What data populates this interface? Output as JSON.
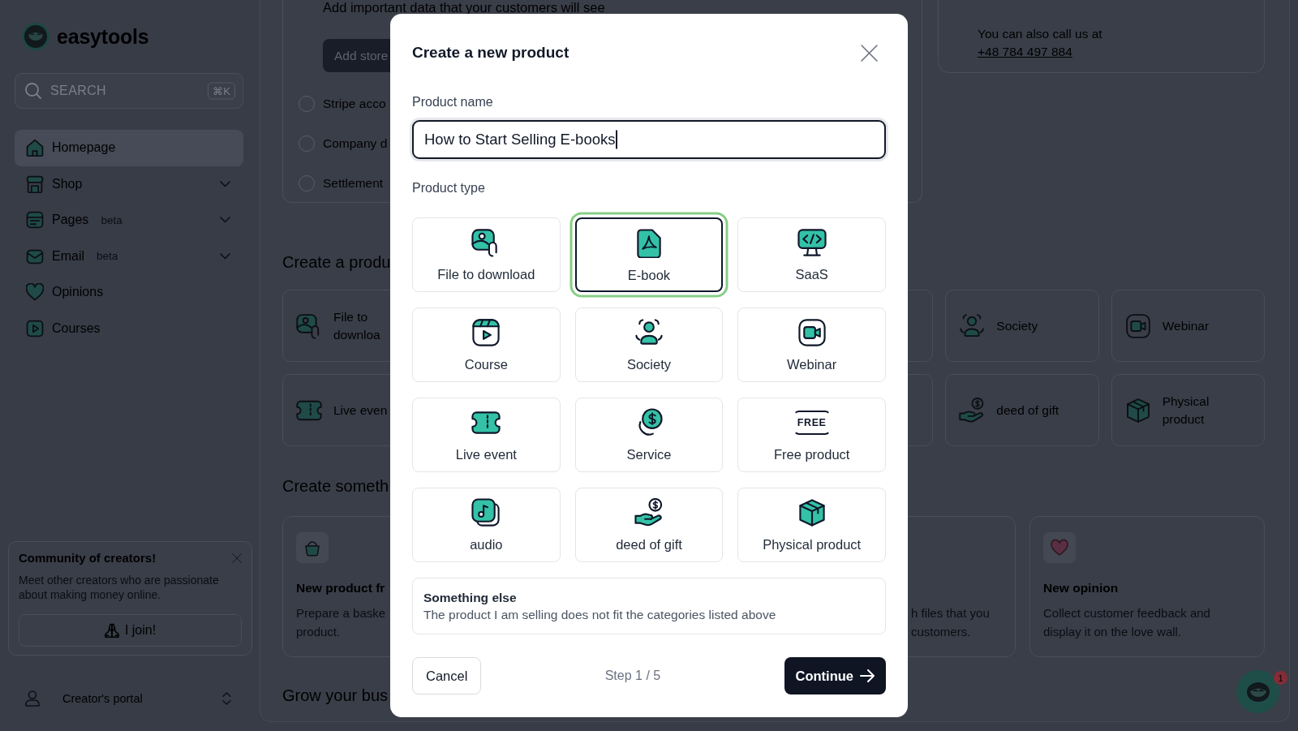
{
  "sidebar": {
    "brand": "easytools",
    "search": {
      "placeholder": "SEARCH",
      "shortcut": "⌘K"
    },
    "nav": [
      {
        "label": "Homepage",
        "kind": "home",
        "selected": true,
        "submenu": false
      },
      {
        "label": "Shop",
        "kind": "shop",
        "selected": false,
        "submenu": true
      },
      {
        "label": "Pages",
        "kind": "pages",
        "badge": "beta",
        "selected": false,
        "submenu": true
      },
      {
        "label": "Email",
        "kind": "email",
        "badge": "beta",
        "selected": false,
        "submenu": true
      },
      {
        "label": "Opinions",
        "kind": "heart",
        "selected": false,
        "submenu": false
      },
      {
        "label": "Courses",
        "kind": "course",
        "selected": false,
        "submenu": false
      }
    ],
    "promo": {
      "title": "Community of creators!",
      "text": "Meet other creators who are passionate about making money online.",
      "button": "I join!"
    },
    "account": {
      "label": "Creator's portal"
    }
  },
  "main": {
    "setup": {
      "intro": "Add important data that your customers will see",
      "button": "Add store",
      "steps": [
        {
          "label": "Stripe acco",
          "checked": false
        },
        {
          "label": "Company d",
          "checked": false
        },
        {
          "label": "Settlement",
          "checked": false
        }
      ]
    },
    "contact": {
      "text": "You can also call us at",
      "phone": "+48 784 497 884"
    },
    "create_product": {
      "heading": "Create a produ",
      "rows": [
        {
          "left": {
            "kind": "file",
            "label": "File to downloa"
          },
          "right": [
            {
              "kind": "society",
              "label": "Society"
            },
            {
              "kind": "webinar",
              "label": "Webinar"
            }
          ]
        },
        {
          "left": {
            "kind": "live",
            "label": "Live even"
          },
          "right": [
            {
              "kind": "gift",
              "label": "deed of gift"
            },
            {
              "kind": "physical",
              "label": "Physical product"
            }
          ]
        }
      ]
    },
    "create_something": {
      "heading": "Create someth",
      "left": {
        "kind": "basket",
        "title": "New product fr",
        "text": "Prepare a baske product."
      },
      "middle_text": "h files that you customers.",
      "right": {
        "kind": "heart",
        "title": "New opinion",
        "text": "Collect customer feedback and display it on the love wall."
      }
    },
    "grow": {
      "heading": "Grow your bus"
    }
  },
  "chat": {
    "badge": "1"
  },
  "modal": {
    "title": "Create a new product",
    "name_label": "Product name",
    "name_value": "How to Start Selling E-books",
    "type_label": "Product type",
    "type_rows": [
      [
        {
          "kind": "file",
          "label": "File to download",
          "selected": false
        },
        {
          "kind": "ebook",
          "label": "E-book",
          "selected": true
        },
        {
          "kind": "saas",
          "label": "SaaS",
          "selected": false
        }
      ],
      [
        {
          "kind": "course",
          "label": "Course",
          "selected": false
        },
        {
          "kind": "society",
          "label": "Society",
          "selected": false
        },
        {
          "kind": "webinar",
          "label": "Webinar",
          "selected": false
        }
      ],
      [
        {
          "kind": "live",
          "label": "Live event",
          "selected": false
        },
        {
          "kind": "service",
          "label": "Service",
          "selected": false
        },
        {
          "kind": "free",
          "badge": "FREE",
          "label": "Free product",
          "selected": false
        }
      ],
      [
        {
          "kind": "audio",
          "label": "audio",
          "selected": false
        },
        {
          "kind": "gift",
          "label": "deed of gift",
          "selected": false
        },
        {
          "kind": "physical",
          "label": "Physical product",
          "selected": false
        }
      ]
    ],
    "other": {
      "title": "Something else",
      "text": "The product I am selling does not fit the categories listed above",
      "selected": false
    },
    "cancel": "Cancel",
    "step": "Step 1 / 5",
    "continue": "Continue"
  }
}
